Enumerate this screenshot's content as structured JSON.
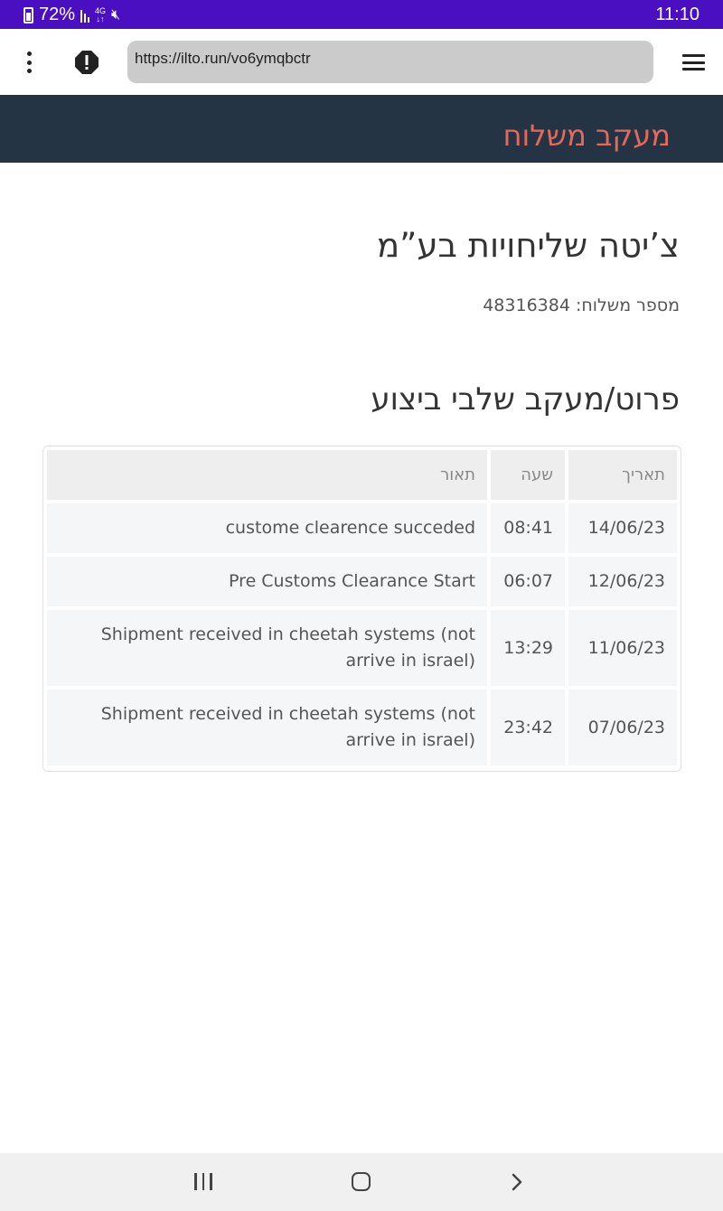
{
  "status_bar": {
    "battery": "72%",
    "network": "4G",
    "time": "11:10"
  },
  "browser": {
    "url": "https://ilto.run/vo6ymqbctr",
    "icons": [
      "more-vert-icon",
      "alert-icon",
      "hamburger-menu-icon"
    ]
  },
  "header": {
    "title": "מעקב משלוח"
  },
  "company": {
    "name": "צ’יטה שליחויות בע”מ"
  },
  "shipment": {
    "number_line": "מספר משלוח: 48316384"
  },
  "tracking": {
    "section_title": "פרוט/מעקב שלבי ביצוע",
    "headers": {
      "date": "תאריך",
      "time": "שעה",
      "description": "תאור"
    },
    "rows": [
      {
        "date": "14/06/23",
        "time": "08:41",
        "description": "custome clearence succeded"
      },
      {
        "date": "12/06/23",
        "time": "06:07",
        "description": "Pre Customs Clearance Start"
      },
      {
        "date": "11/06/23",
        "time": "13:29",
        "description": "Shipment received in cheetah systems (not arrive in israel)"
      },
      {
        "date": "07/06/23",
        "time": "23:42",
        "description": "Shipment received in cheetah systems (not arrive in israel)"
      }
    ]
  },
  "colors": {
    "status_bar": "#4a0fc1",
    "header_bg": "#253444",
    "header_title": "#e5695b"
  }
}
